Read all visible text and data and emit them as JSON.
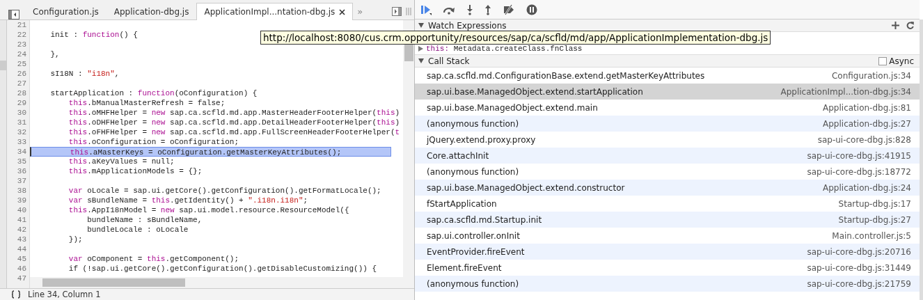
{
  "editor": {
    "tabs": [
      {
        "label": "Configuration.js",
        "selected": false
      },
      {
        "label": "Application-dbg.js",
        "selected": false
      },
      {
        "label": "ApplicationImpl...ntation-dbg.js",
        "selected": true
      }
    ],
    "overflow_label": "»",
    "lines": [
      {
        "number": "21"
      },
      {
        "number": "22",
        "highlighted": false,
        "parts": [
          {
            "kind": "plain",
            "text": "    init : "
          },
          {
            "kind": "keyword",
            "text": "function"
          },
          {
            "kind": "plain",
            "text": "() {"
          }
        ]
      },
      {
        "number": "23"
      },
      {
        "number": "24",
        "highlighted": false,
        "parts": [
          {
            "kind": "plain",
            "text": "    },"
          }
        ]
      },
      {
        "number": "25"
      },
      {
        "number": "26",
        "highlighted": false,
        "parts": [
          {
            "kind": "plain",
            "text": "    sI18N : "
          },
          {
            "kind": "string",
            "text": "\"i18n\""
          },
          {
            "kind": "plain",
            "text": ","
          }
        ]
      },
      {
        "number": "27"
      },
      {
        "number": "28",
        "highlighted": false,
        "parts": [
          {
            "kind": "plain",
            "text": "    startApplication : "
          },
          {
            "kind": "keyword",
            "text": "function"
          },
          {
            "kind": "plain",
            "text": "(oConfiguration) {"
          }
        ]
      },
      {
        "number": "29",
        "highlighted": false,
        "parts": [
          {
            "kind": "keyword",
            "text": "        this"
          },
          {
            "kind": "plain",
            "text": ".bManualMasterRefresh = false;"
          }
        ]
      },
      {
        "number": "30",
        "highlighted": false,
        "parts": [
          {
            "kind": "keyword",
            "text": "        this"
          },
          {
            "kind": "plain",
            "text": ".oMHFHelper = "
          },
          {
            "kind": "keyword",
            "text": "new"
          },
          {
            "kind": "plain",
            "text": " sap.ca.scfld.md.app.MasterHeaderFooterHelper("
          },
          {
            "kind": "keyword",
            "text": "this"
          },
          {
            "kind": "plain",
            "text": ")"
          }
        ]
      },
      {
        "number": "31",
        "highlighted": false,
        "parts": [
          {
            "kind": "keyword",
            "text": "        this"
          },
          {
            "kind": "plain",
            "text": ".oDHFHelper = "
          },
          {
            "kind": "keyword",
            "text": "new"
          },
          {
            "kind": "plain",
            "text": " sap.ca.scfld.md.app.DetailHeaderFooterHelper("
          },
          {
            "kind": "keyword",
            "text": "this"
          },
          {
            "kind": "plain",
            "text": ")"
          }
        ]
      },
      {
        "number": "32",
        "highlighted": false,
        "parts": [
          {
            "kind": "keyword",
            "text": "        this"
          },
          {
            "kind": "plain",
            "text": ".oFHFHelper = "
          },
          {
            "kind": "keyword",
            "text": "new"
          },
          {
            "kind": "plain",
            "text": " sap.ca.scfld.md.app.FullScreenHeaderFooterHelper("
          },
          {
            "kind": "keyword",
            "text": "t"
          }
        ]
      },
      {
        "number": "33",
        "highlighted": false,
        "parts": [
          {
            "kind": "keyword",
            "text": "        this"
          },
          {
            "kind": "plain",
            "text": ".oConfiguration = oConfiguration;"
          }
        ]
      },
      {
        "number": "34",
        "highlighted": true,
        "parts": [
          {
            "kind": "keyword",
            "text": "        this"
          },
          {
            "kind": "plain",
            "text": ".aMasterKeys = oConfiguration.getMasterKeyAttributes();"
          }
        ]
      },
      {
        "number": "35",
        "highlighted": false,
        "parts": [
          {
            "kind": "keyword",
            "text": "        this"
          },
          {
            "kind": "plain",
            "text": ".aKeyValues = null;"
          }
        ]
      },
      {
        "number": "36",
        "highlighted": false,
        "parts": [
          {
            "kind": "keyword",
            "text": "        this"
          },
          {
            "kind": "plain",
            "text": ".mApplicationModels = {};"
          }
        ]
      },
      {
        "number": "37"
      },
      {
        "number": "38",
        "highlighted": false,
        "parts": [
          {
            "kind": "keyword",
            "text": "        var"
          },
          {
            "kind": "plain",
            "text": " oLocale = sap.ui.getCore().getConfiguration().getFormatLocale();"
          }
        ]
      },
      {
        "number": "39",
        "highlighted": false,
        "parts": [
          {
            "kind": "keyword",
            "text": "        var"
          },
          {
            "kind": "plain",
            "text": " sBundleName = "
          },
          {
            "kind": "keyword",
            "text": "this"
          },
          {
            "kind": "plain",
            "text": ".getIdentity() + "
          },
          {
            "kind": "string",
            "text": "\".i18n.i18n\""
          },
          {
            "kind": "plain",
            "text": ";"
          }
        ]
      },
      {
        "number": "40",
        "highlighted": false,
        "parts": [
          {
            "kind": "keyword",
            "text": "        this"
          },
          {
            "kind": "plain",
            "text": ".AppI18nModel = "
          },
          {
            "kind": "keyword",
            "text": "new"
          },
          {
            "kind": "plain",
            "text": " sap.ui.model.resource.ResourceModel({"
          }
        ]
      },
      {
        "number": "41",
        "highlighted": false,
        "parts": [
          {
            "kind": "plain",
            "text": "            bundleName : sBundleName,"
          }
        ]
      },
      {
        "number": "42",
        "highlighted": false,
        "parts": [
          {
            "kind": "plain",
            "text": "            bundleLocale : oLocale"
          }
        ]
      },
      {
        "number": "43",
        "highlighted": false,
        "parts": [
          {
            "kind": "plain",
            "text": "        });"
          }
        ]
      },
      {
        "number": "44"
      },
      {
        "number": "45",
        "highlighted": false,
        "parts": [
          {
            "kind": "keyword",
            "text": "        var"
          },
          {
            "kind": "plain",
            "text": " oComponent = "
          },
          {
            "kind": "keyword",
            "text": "this"
          },
          {
            "kind": "plain",
            "text": ".getComponent();"
          }
        ]
      },
      {
        "number": "46",
        "highlighted": false,
        "parts": [
          {
            "kind": "plain",
            "text": "        if (!sap.ui.getCore().getConfiguration().getDisableCustomizing()) {"
          }
        ]
      },
      {
        "number": "47"
      }
    ],
    "status": "Line 34, Column 1"
  },
  "tooltip": "http://localhost:8080/cus.crm.opportunity/resources/sap/ca/scfld/md/app/ApplicationImplementation-dbg.js",
  "watch": {
    "title": "Watch Expressions",
    "scope_item": {
      "name": "this:",
      "value": "Metadata.createClass.fnClass"
    }
  },
  "call_stack": {
    "title": "Call Stack",
    "async": {
      "label": "Async",
      "checked": false
    },
    "frames": [
      {
        "function": "sap.ca.scfld.md.ConfigurationBase.extend.getMasterKeyAttributes",
        "location": "Configuration.js:34",
        "selected": false
      },
      {
        "function": "sap.ui.base.ManagedObject.extend.startApplication",
        "location": "ApplicationImpl...tion-dbg.js:34",
        "selected": true
      },
      {
        "function": "sap.ui.base.ManagedObject.extend.main",
        "location": "Application-dbg.js:81",
        "selected": false
      },
      {
        "function": "(anonymous function)",
        "location": "Application-dbg.js:27",
        "selected": false
      },
      {
        "function": "jQuery.extend.proxy.proxy",
        "location": "sap-ui-core-dbg.js:828",
        "selected": false
      },
      {
        "function": "Core.attachInit",
        "location": "sap-ui-core-dbg.js:41915",
        "selected": false
      },
      {
        "function": "(anonymous function)",
        "location": "sap-ui-core-dbg.js:18772",
        "selected": false
      },
      {
        "function": "sap.ui.base.ManagedObject.extend.constructor",
        "location": "Application-dbg.js:24",
        "selected": false
      },
      {
        "function": "fStartApplication",
        "location": "Startup-dbg.js:17",
        "selected": false
      },
      {
        "function": "sap.ca.scfld.md.Startup.init",
        "location": "Startup-dbg.js:27",
        "selected": false
      },
      {
        "function": "sap.ui.controller.onInit",
        "location": "Main.controller.js:5",
        "selected": false
      },
      {
        "function": "EventProvider.fireEvent",
        "location": "sap-ui-core-dbg.js:20716",
        "selected": false
      },
      {
        "function": "Element.fireEvent",
        "location": "sap-ui-core-dbg.js:31449",
        "selected": false
      },
      {
        "function": "(anonymous function)",
        "location": "sap-ui-core-dbg.js:21759",
        "selected": false
      }
    ]
  }
}
